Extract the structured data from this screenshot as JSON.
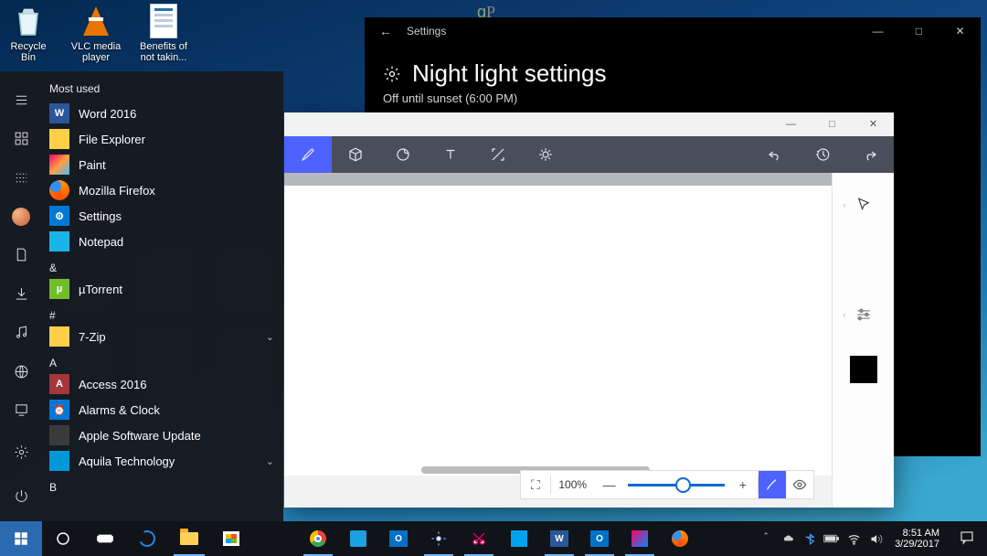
{
  "desktop": {
    "icons": [
      {
        "label": "Recycle Bin"
      },
      {
        "label": "VLC media player"
      },
      {
        "label": "Benefits of not takin..."
      }
    ],
    "watermark": "gP"
  },
  "settings_window": {
    "back": "←",
    "title_label": "Settings",
    "controls": {
      "min": "—",
      "max": "□",
      "close": "✕"
    },
    "page_title": "Night light settings",
    "subtitle": "Off until sunset (6:00 PM)"
  },
  "paint_window": {
    "controls": {
      "min": "—",
      "max": "□",
      "close": "✕"
    },
    "tools": [
      "brush",
      "3d",
      "sticker",
      "text",
      "canvas",
      "effects"
    ],
    "history": [
      "undo",
      "history",
      "redo"
    ],
    "side": [
      "cursor",
      "marker",
      "adjust",
      "color"
    ],
    "zoom": {
      "fit": "⛶",
      "value": "100%",
      "minus": "—",
      "plus": "+"
    }
  },
  "start_menu": {
    "header": "Most used",
    "most_used": [
      {
        "icon": "word",
        "label": "Word 2016"
      },
      {
        "icon": "fe",
        "label": "File Explorer"
      },
      {
        "icon": "paint",
        "label": "Paint"
      },
      {
        "icon": "ff",
        "label": "Mozilla Firefox"
      },
      {
        "icon": "set",
        "label": "Settings"
      },
      {
        "icon": "np",
        "label": "Notepad"
      }
    ],
    "letters": {
      "amp": "&",
      "hash": "#",
      "a": "A",
      "b": "B"
    },
    "amp_items": [
      {
        "icon": "ut",
        "label": "µTorrent"
      }
    ],
    "hash_items": [
      {
        "icon": "zip",
        "label": "7-Zip",
        "chevron": true
      }
    ],
    "a_items": [
      {
        "icon": "acc",
        "label": "Access 2016"
      },
      {
        "icon": "alarm",
        "label": "Alarms & Clock"
      },
      {
        "icon": "apple",
        "label": "Apple Software Update"
      },
      {
        "icon": "aq",
        "label": "Aquila Technology",
        "chevron": true
      }
    ]
  },
  "taskbar": {
    "clock": {
      "time": "8:51 AM",
      "date": "3/29/2017"
    },
    "chevron": "＾"
  }
}
